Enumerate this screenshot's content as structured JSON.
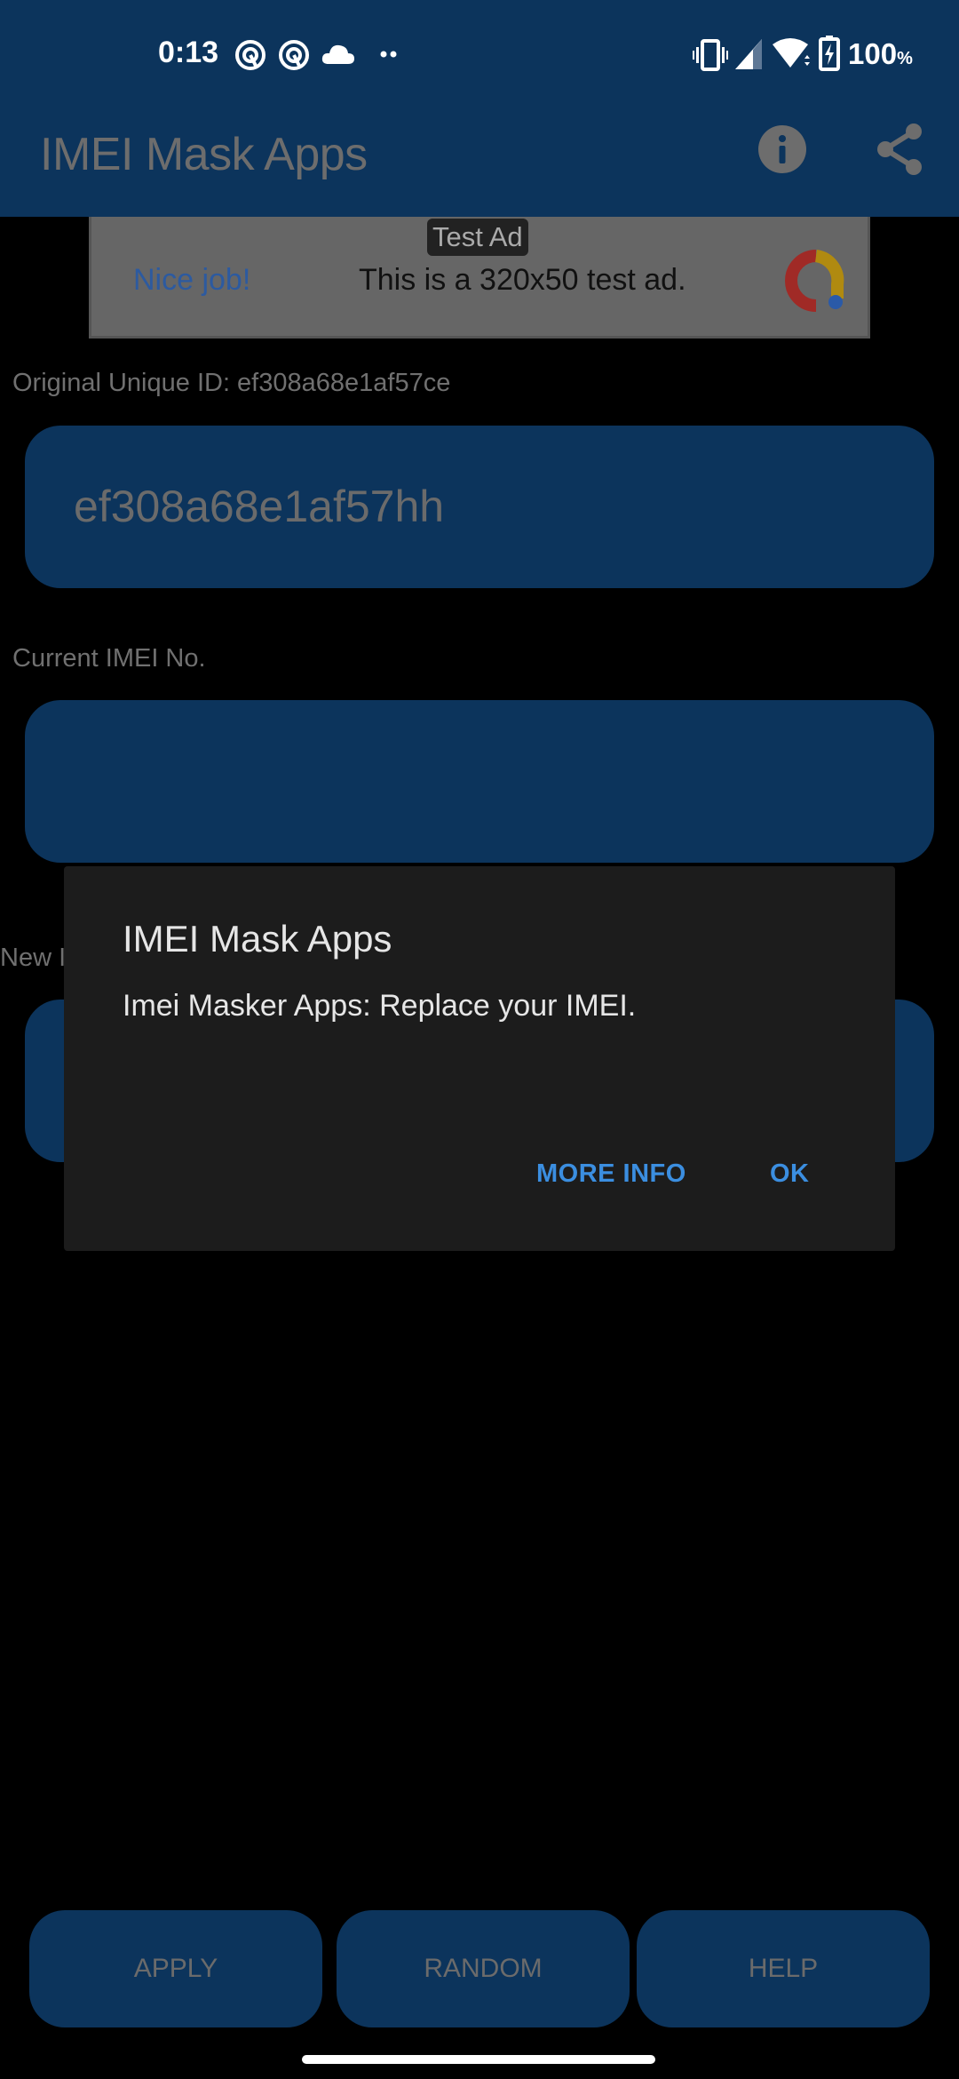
{
  "status_bar": {
    "time": "0:13",
    "left_icons": [
      "at-sign-icon",
      "at-sign-icon",
      "cloud-icon",
      "more-dots-icon"
    ],
    "right_icons": [
      "vibrate-icon",
      "signal-icon",
      "wifi-icon",
      "battery-charging-icon"
    ],
    "battery_value": "100",
    "battery_unit": "%"
  },
  "app_bar": {
    "title": "IMEI Mask Apps",
    "actions": [
      "info-icon",
      "share-icon"
    ]
  },
  "ad_banner": {
    "badge": "Test Ad",
    "headline": "Nice job!",
    "text": "This is a 320x50 test ad.",
    "colors": {
      "headline": "#2c5aa0",
      "logo_red": "#c0302a",
      "logo_yellow": "#d9a400",
      "logo_blue": "#2a62c4"
    }
  },
  "main": {
    "original_id_label": "Original Unique ID: ef308a68e1af57ce",
    "original_id_field_value": "ef308a68e1af57hh",
    "current_imei_label": "Current IMEI No.",
    "current_imei_value": "",
    "new_imei_label_partial": "New I"
  },
  "dialog": {
    "title": "IMEI Mask Apps",
    "message": "Imei Masker Apps: Replace your IMEI.",
    "buttons": {
      "more_info": "MORE INFO",
      "ok": "OK"
    }
  },
  "bottom_buttons": {
    "apply": "APPLY",
    "random": "RANDOM",
    "help": "HELP"
  },
  "colors": {
    "app_bar": "#0c345c",
    "field": "#0c345c",
    "dialog_bg": "#1c1c1c",
    "dialog_button": "#3b8ee0"
  }
}
